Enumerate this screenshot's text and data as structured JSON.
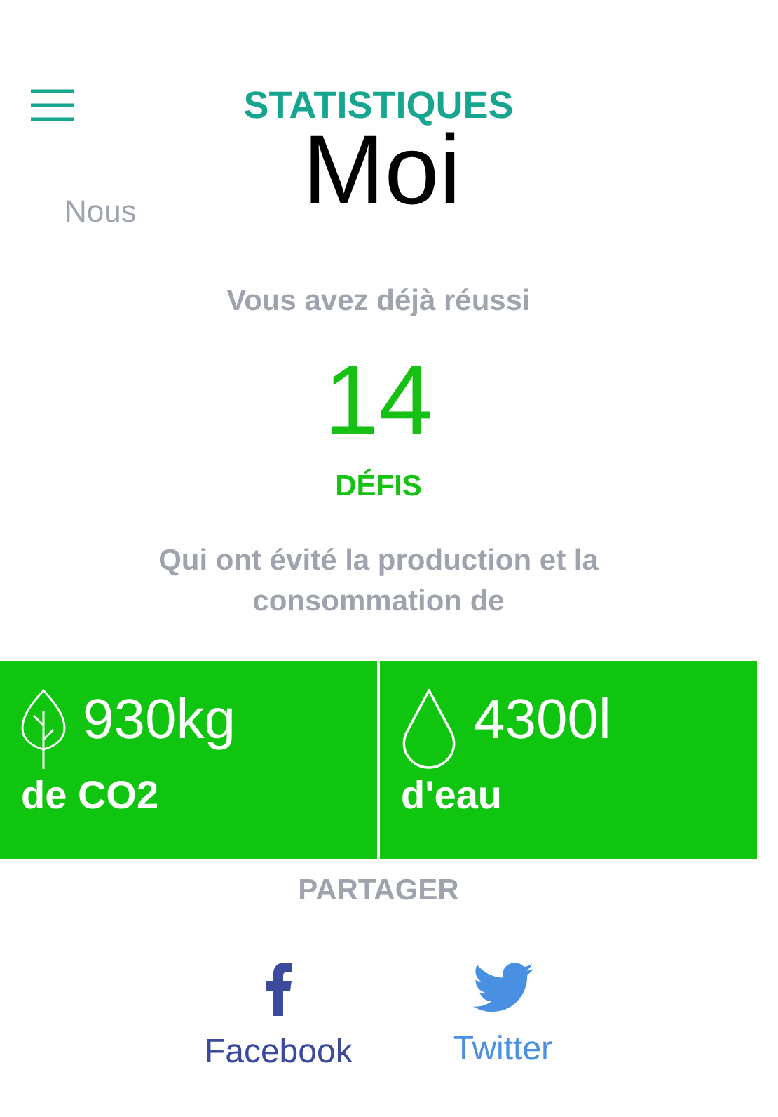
{
  "header": {
    "title": "STATISTIQUES"
  },
  "tabs": [
    {
      "label": "Moi",
      "selected": true
    },
    {
      "label": "Nous",
      "selected": false
    }
  ],
  "summary": {
    "intro": "Vous avez déjà réussi",
    "count": "14",
    "unit": "DÉFIS",
    "outro": "Qui ont évité la production et la consommation de"
  },
  "stats": [
    {
      "kind": "co2",
      "value": "930kg",
      "label": "de CO2"
    },
    {
      "kind": "water",
      "value": "4300l",
      "label": "d'eau"
    }
  ],
  "share": {
    "title": "PARTAGER",
    "links": [
      {
        "kind": "facebook",
        "label": "Facebook"
      },
      {
        "kind": "twitter",
        "label": "Twitter"
      }
    ]
  }
}
